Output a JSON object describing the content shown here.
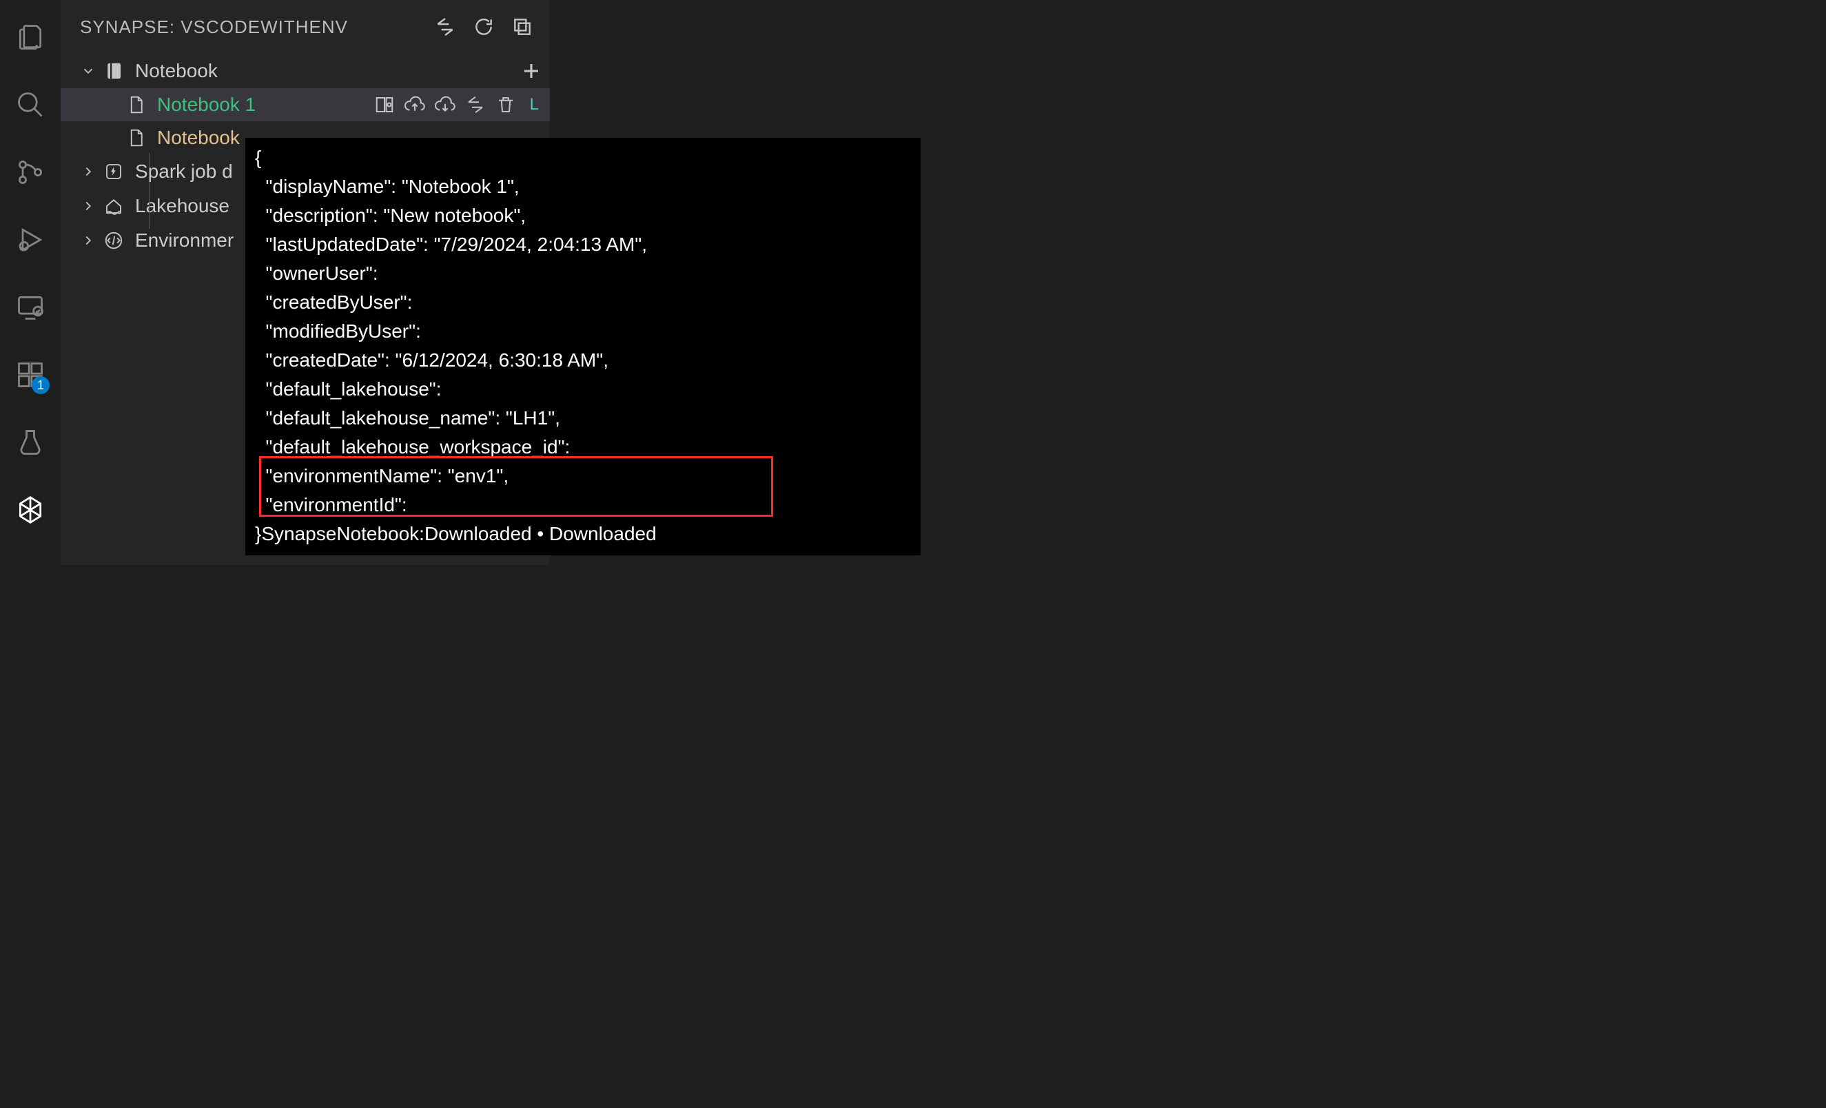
{
  "activity_bar": {
    "items": [
      {
        "name": "explorer",
        "icon": "files"
      },
      {
        "name": "search",
        "icon": "search"
      },
      {
        "name": "source-control",
        "icon": "git"
      },
      {
        "name": "run-debug",
        "icon": "debug"
      },
      {
        "name": "remote",
        "icon": "remote"
      },
      {
        "name": "extensions",
        "icon": "extensions",
        "badge": "1"
      },
      {
        "name": "testing",
        "icon": "beaker"
      },
      {
        "name": "synapse",
        "icon": "synapse"
      }
    ]
  },
  "panel": {
    "title": "SYNAPSE: VSCODEWITHENV",
    "header_actions": [
      {
        "name": "sync",
        "icon": "sync-arrows"
      },
      {
        "name": "refresh",
        "icon": "refresh"
      },
      {
        "name": "collapse-all",
        "icon": "collapse"
      }
    ],
    "tree": {
      "notebook_section": {
        "label": "Notebook",
        "expanded": true,
        "add_tooltip": "Add",
        "items": [
          {
            "label": "Notebook 1",
            "color": "green",
            "selected": true,
            "actions": [
              {
                "name": "open-layout",
                "icon": "layout"
              },
              {
                "name": "upload",
                "icon": "cloud-up"
              },
              {
                "name": "download",
                "icon": "cloud-down"
              },
              {
                "name": "sync",
                "icon": "sync-arrows"
              },
              {
                "name": "delete",
                "icon": "trash"
              }
            ],
            "status": "L"
          },
          {
            "label": "Notebook",
            "color": "orange",
            "selected": false
          }
        ]
      },
      "other_sections": [
        {
          "label": "Spark job d",
          "icon": "sparkjob"
        },
        {
          "label": "Lakehouse",
          "icon": "lakehouse"
        },
        {
          "label": "Environmer",
          "icon": "environment"
        }
      ]
    }
  },
  "tooltip": {
    "lines": [
      "{",
      "  \"displayName\": \"Notebook 1\",",
      "  \"description\": \"New notebook\",",
      "  \"lastUpdatedDate\": \"7/29/2024, 2:04:13 AM\",",
      "  \"ownerUser\":",
      "  \"createdByUser\":",
      "  \"modifiedByUser\":",
      "  \"createdDate\": \"6/12/2024, 6:30:18 AM\",",
      "  \"default_lakehouse\":",
      "  \"default_lakehouse_name\": \"LH1\",",
      "  \"default_lakehouse_workspace_id\":",
      "  \"environmentName\": \"env1\",",
      "  \"environmentId\":",
      "}SynapseNotebook:Downloaded • Downloaded"
    ]
  }
}
